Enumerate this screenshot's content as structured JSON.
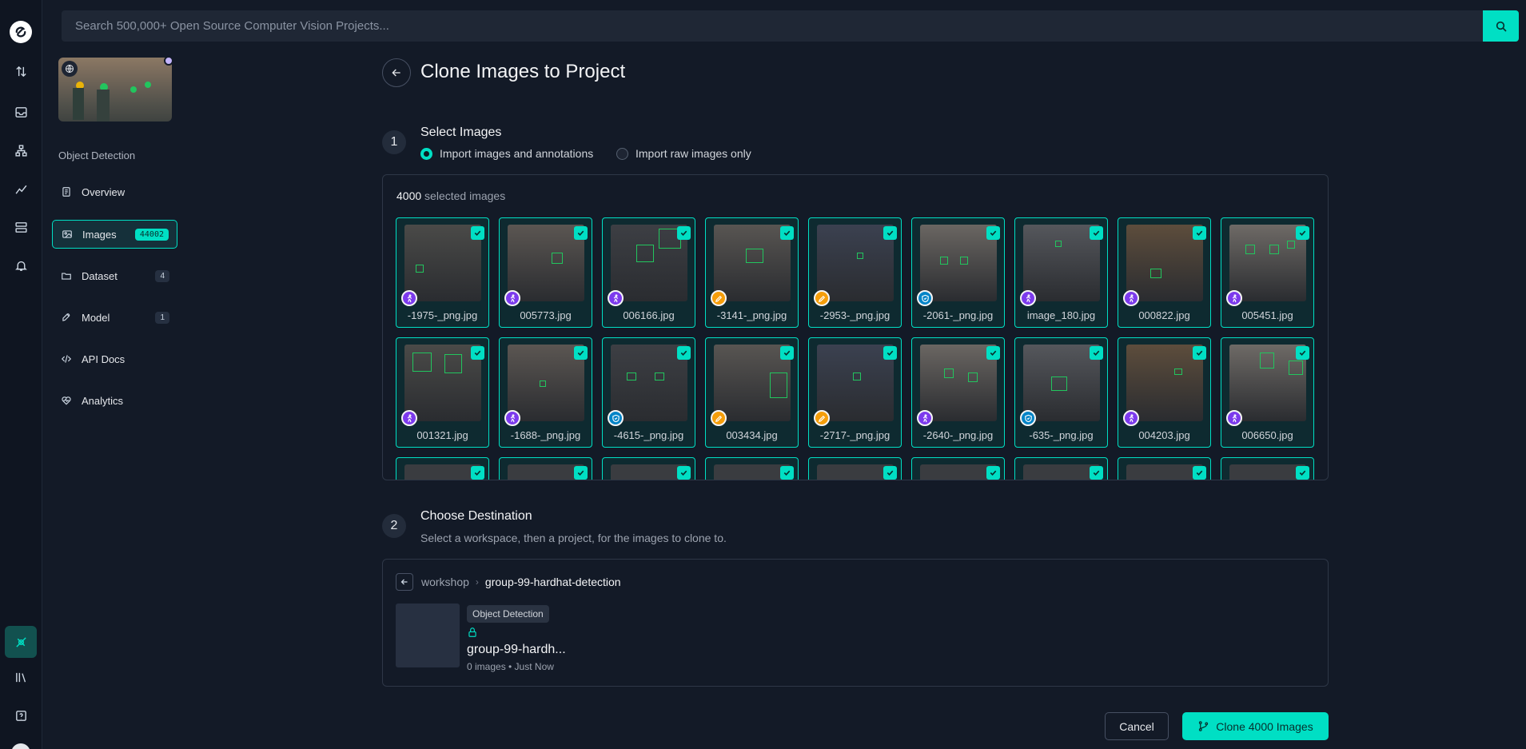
{
  "search": {
    "placeholder": "Search 500,000+ Open Source Computer Vision Projects..."
  },
  "sidebar": {
    "project_type": "Object Detection",
    "items": [
      {
        "label": "Overview",
        "icon": "document-icon",
        "badge": ""
      },
      {
        "label": "Images",
        "icon": "image-icon",
        "badge": "44002"
      },
      {
        "label": "Dataset",
        "icon": "folder-icon",
        "badge": "4"
      },
      {
        "label": "Model",
        "icon": "rocket-icon",
        "badge": "1"
      },
      {
        "label": "API Docs",
        "icon": "code-icon",
        "badge": ""
      },
      {
        "label": "Analytics",
        "icon": "heart-pulse-icon",
        "badge": ""
      }
    ]
  },
  "page": {
    "title": "Clone Images to Project"
  },
  "step1": {
    "number": "1",
    "title": "Select Images",
    "options": [
      {
        "label": "Import images and annotations",
        "selected": true
      },
      {
        "label": "Import raw images only",
        "selected": false
      }
    ],
    "selected_count": "4000",
    "selected_suffix": "selected images",
    "images": [
      {
        "name": "-1975-_png.jpg",
        "badge": "purple"
      },
      {
        "name": "005773.jpg",
        "badge": "purple"
      },
      {
        "name": "006166.jpg",
        "badge": "purple"
      },
      {
        "name": "-3141-_png.jpg",
        "badge": "orange"
      },
      {
        "name": "-2953-_png.jpg",
        "badge": "orange"
      },
      {
        "name": "-2061-_png.jpg",
        "badge": "blue"
      },
      {
        "name": "image_180.jpg",
        "badge": "purple"
      },
      {
        "name": "000822.jpg",
        "badge": "purple"
      },
      {
        "name": "005451.jpg",
        "badge": "purple"
      },
      {
        "name": "001321.jpg",
        "badge": "purple"
      },
      {
        "name": "-1688-_png.jpg",
        "badge": "purple"
      },
      {
        "name": "-4615-_png.jpg",
        "badge": "blue"
      },
      {
        "name": "003434.jpg",
        "badge": "orange"
      },
      {
        "name": "-2717-_png.jpg",
        "badge": "orange"
      },
      {
        "name": "-2640-_png.jpg",
        "badge": "purple"
      },
      {
        "name": "-635-_png.jpg",
        "badge": "blue"
      },
      {
        "name": "004203.jpg",
        "badge": "purple"
      },
      {
        "name": "006650.jpg",
        "badge": "purple"
      }
    ]
  },
  "step2": {
    "number": "2",
    "title": "Choose Destination",
    "subtitle": "Select a workspace, then a project, for the images to clone to.",
    "breadcrumb": {
      "workspace": "workshop",
      "project": "group-99-hardhat-detection"
    },
    "project": {
      "type": "Object Detection",
      "name": "group-99-hardh...",
      "meta": "0 images • Just Now"
    }
  },
  "actions": {
    "cancel": "Cancel",
    "clone": "Clone 4000 Images"
  },
  "colors": {
    "accent": "#00dfc4",
    "background": "#131a27",
    "badge_purple": "#7c3aed",
    "badge_orange": "#f59e0b",
    "badge_blue": "#0284c7"
  }
}
